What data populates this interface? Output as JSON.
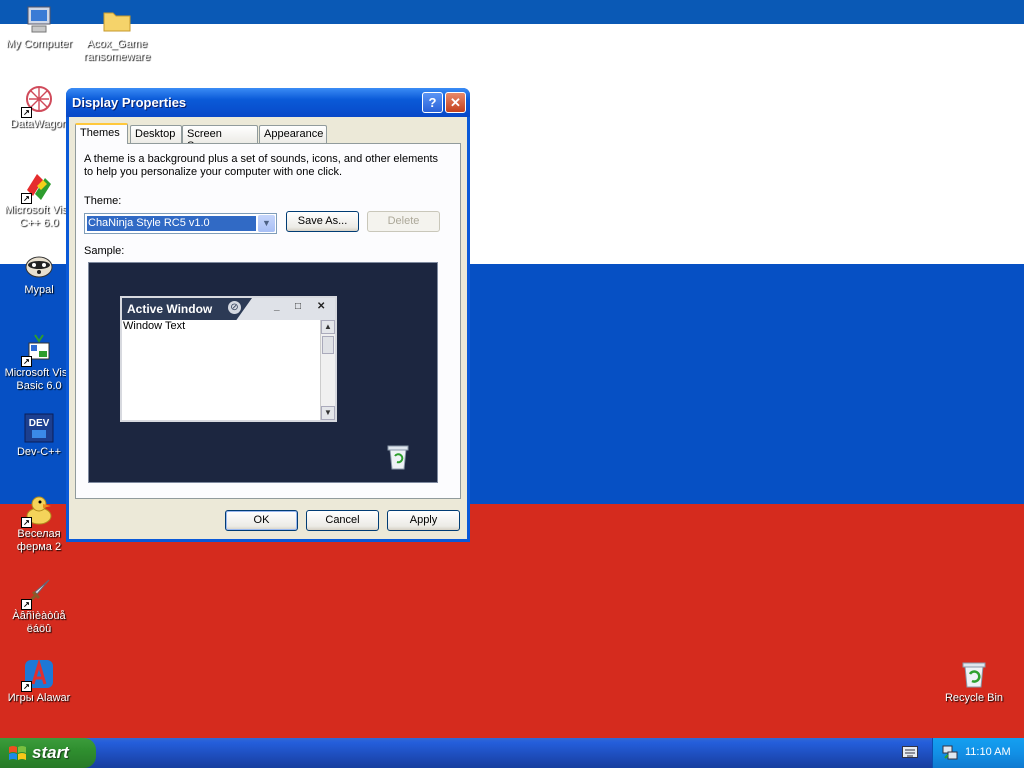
{
  "desktop": {
    "wallpaper_colors": {
      "top_bar": "#0a59b5",
      "white": "#ffffff",
      "blue": "#0650c4",
      "red": "#d52b1e"
    },
    "icons": [
      {
        "name": "my-computer",
        "label": "My Computer",
        "icon": "computer-icon"
      },
      {
        "name": "acox-game",
        "label": "Acox_Game\nransomeware",
        "icon": "folder-icon"
      },
      {
        "name": "datawagon",
        "label": "DataWagon",
        "icon": "datawagon-icon"
      },
      {
        "name": "visual-cpp",
        "label": "Microsoft Visu\nC++ 6.0",
        "icon": "visual-cpp-icon"
      },
      {
        "name": "mypal",
        "label": "Mypal",
        "icon": "raccoon-icon"
      },
      {
        "name": "visual-basic",
        "label": "Microsoft Visu\nBasic 6.0",
        "icon": "visual-basic-icon"
      },
      {
        "name": "dev-cpp",
        "label": "Dev-C++",
        "icon": "dev-cpp-icon"
      },
      {
        "name": "farm",
        "label": "Веселая\nферма 2",
        "icon": "duck-icon"
      },
      {
        "name": "garbled",
        "label": "Àâñìèàòûå\nëáöû",
        "icon": "sword-icon"
      },
      {
        "name": "alawar",
        "label": "Игры Alawar",
        "icon": "alawar-icon"
      },
      {
        "name": "recycle-bin",
        "label": "Recycle Bin",
        "icon": "recycle-bin-icon"
      }
    ]
  },
  "window": {
    "title": "Display Properties",
    "help_glyph": "?",
    "close_glyph": "✕",
    "tabs": [
      {
        "label": "Themes",
        "active": true
      },
      {
        "label": "Desktop"
      },
      {
        "label": "Screen Saver"
      },
      {
        "label": "Appearance"
      }
    ],
    "description": "A theme is a background plus a set of sounds, icons, and other elements to help you personalize your computer with one click.",
    "theme_label": "Theme:",
    "theme_value": "ChaNinja Style RC5 v1.0",
    "save_as": "Save As...",
    "delete": "Delete",
    "sample_label": "Sample:",
    "sample": {
      "window_title": "Active Window",
      "window_text": "Window Text",
      "minimize": "_",
      "maximize": "□",
      "close": "✕"
    },
    "ok": "OK",
    "cancel": "Cancel",
    "apply": "Apply"
  },
  "taskbar": {
    "start_label": "start",
    "clock": "11:10 AM"
  }
}
